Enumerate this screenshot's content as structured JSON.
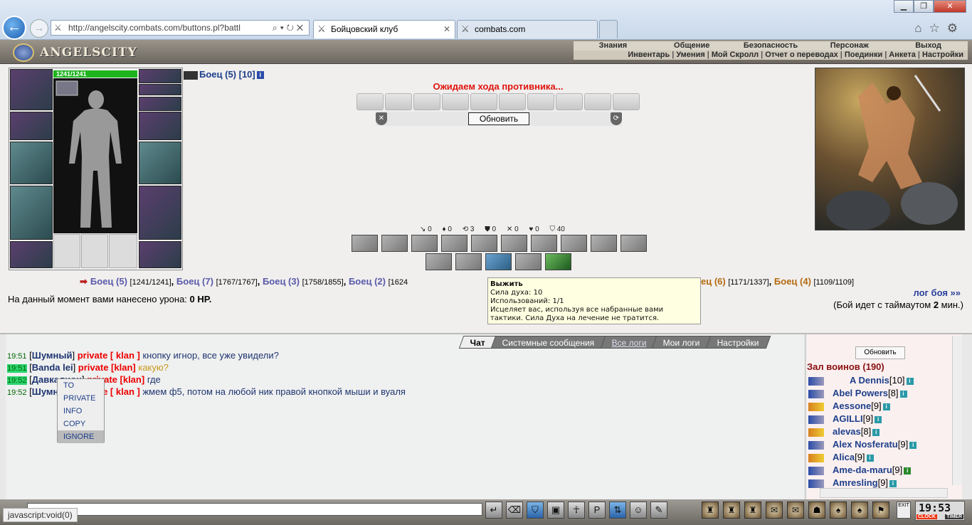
{
  "browser": {
    "address": "http://angelscity.combats.com/buttons.pl?battl",
    "tabs": [
      {
        "label": "Бойцовский клуб"
      },
      {
        "label": "combats.com"
      }
    ]
  },
  "header": {
    "logo": "ANGELSCITY",
    "nav_top": [
      "Знания",
      "Общение",
      "Безопасность",
      "Персонаж",
      "Выход"
    ],
    "nav_bottom": [
      "Инвентарь",
      "Умения",
      "Мой Скролл",
      "Отчет о переводах",
      "Поединки",
      "Анкета",
      "Настройки"
    ]
  },
  "player": {
    "hp": "1241/1241"
  },
  "battle": {
    "opponent": "Боец (5) [10]",
    "wait_message": "Ожидаем хода противника...",
    "refresh_label": "Обновить",
    "stats": [
      "0",
      "0",
      "3",
      "0",
      "0",
      "0",
      "40"
    ],
    "fighters": [
      {
        "name": "Боец (5)",
        "hp": "[1241/1241]"
      },
      {
        "name": "Боец (7)",
        "hp": "[1767/1767]"
      },
      {
        "name": "Боец (3)",
        "hp": "[1758/1855]"
      },
      {
        "name": "Боец (2)",
        "hp": "[1624"
      },
      {
        "name": "ец (6)",
        "hp": "[1171/1337]"
      },
      {
        "name": "Боец (4)",
        "hp": "[1109/1109]"
      }
    ],
    "separator": ",",
    "damage_text": "На данный момент вами нанесено урона: ",
    "damage_value": "0 HP.",
    "log_link": "лог боя »»",
    "timeout_pre": "(Бой идет с таймаутом ",
    "timeout_value": "2",
    "timeout_post": " мин.)"
  },
  "tooltip": {
    "title": "Выжить",
    "line1": "Сила духа: 10",
    "line2": "Использований: 1/1",
    "line3": "Исцеляет вас, используя все набранные вами",
    "line4": "тактики. Сила Духа на лечение не тратится."
  },
  "chat": {
    "tabs": [
      "Чат",
      "Системные сообщения",
      "Все логи",
      "Мои логи",
      "Настройки"
    ],
    "lines": [
      {
        "time": "19:51",
        "nick": "Шумный",
        "priv": "private [ klan ]",
        "msg": "кнопку игнор, все уже увидели?"
      },
      {
        "time": "19:51",
        "nick": "Banda lei",
        "priv": "private [klan]",
        "msg": "какую?"
      },
      {
        "time": "19:52",
        "nick": "Давкалион",
        "priv": "private [klan]",
        "msg": "где"
      },
      {
        "time": "19:52",
        "nick": "Шумный",
        "priv": "private [ klan ]",
        "msg": "жмем ф5, потом на любой ник правой кнопкой мыши и вуаля"
      }
    ],
    "context_menu": [
      "TO",
      "PRIVATE",
      "INFO",
      "COPY",
      "IGNORE"
    ]
  },
  "warriors": {
    "refresh_label": "Обновить",
    "title": "Зал воинов (190)",
    "list": [
      {
        "name": "A Dennis",
        "level": "[10]"
      },
      {
        "name": "Abel Powers",
        "level": "[8]"
      },
      {
        "name": "Aessone",
        "level": "[9]"
      },
      {
        "name": "AGILLI",
        "level": "[9]"
      },
      {
        "name": "alevas",
        "level": "[8]"
      },
      {
        "name": "Alex Nosferatu",
        "level": "[9]"
      },
      {
        "name": "Alica",
        "level": "[9]"
      },
      {
        "name": "Ame-da-maru",
        "level": "[9]"
      },
      {
        "name": "Amresling",
        "level": "[9]"
      }
    ]
  },
  "footer": {
    "status": "javascript:void(0)",
    "clock": "19:53",
    "clock_label": "CLOCK",
    "timer_label": "TIMER",
    "exit_label": "EXIT"
  }
}
